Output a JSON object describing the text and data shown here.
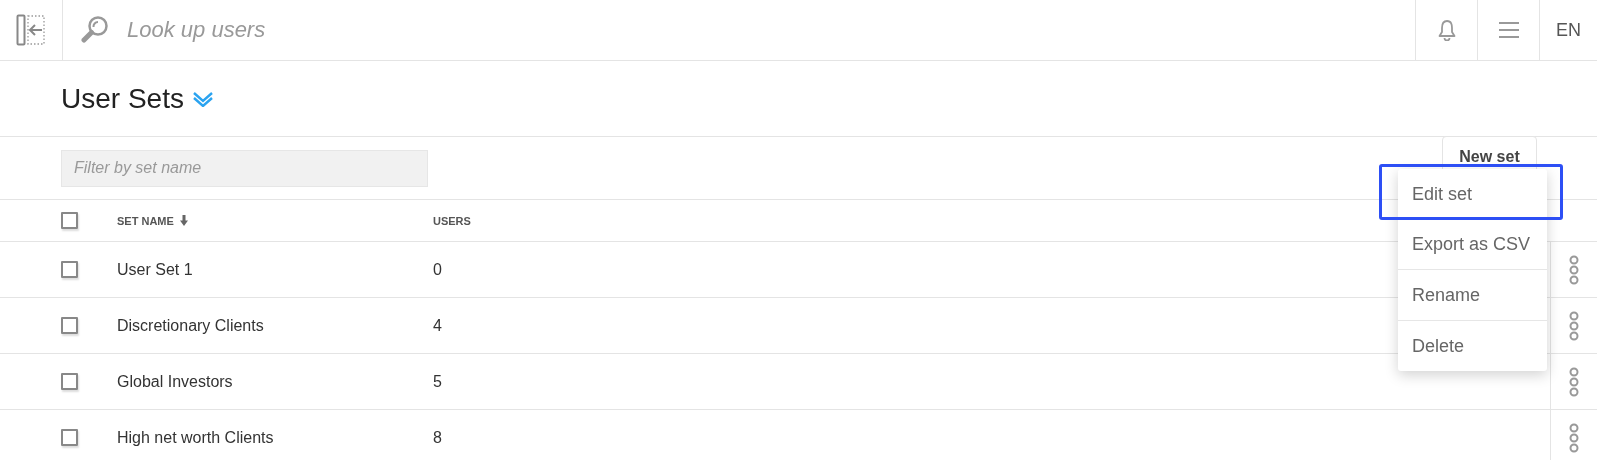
{
  "header": {
    "search": {
      "placeholder": "Look up users"
    },
    "language": "EN"
  },
  "page_title": "User Sets",
  "filter": {
    "placeholder": "Filter by set name"
  },
  "new_set_button": "New set",
  "table": {
    "select_all_checked": false,
    "columns": [
      {
        "label": "SET NAME",
        "sorted": true
      },
      {
        "label": "USERS"
      }
    ],
    "rows": [
      {
        "name": "User Set 1",
        "users": "0",
        "checked": false
      },
      {
        "name": "Discretionary Clients",
        "users": "4",
        "checked": false
      },
      {
        "name": "Global Investors",
        "users": "5",
        "checked": false
      },
      {
        "name": "High net worth Clients",
        "users": "8",
        "checked": false
      }
    ]
  },
  "context_menu": {
    "items": [
      {
        "label": "Edit set",
        "highlighted": true
      },
      {
        "label": "Export as CSV",
        "highlighted": false
      },
      {
        "label": "Rename",
        "highlighted": false
      },
      {
        "label": "Delete",
        "highlighted": false
      }
    ]
  }
}
